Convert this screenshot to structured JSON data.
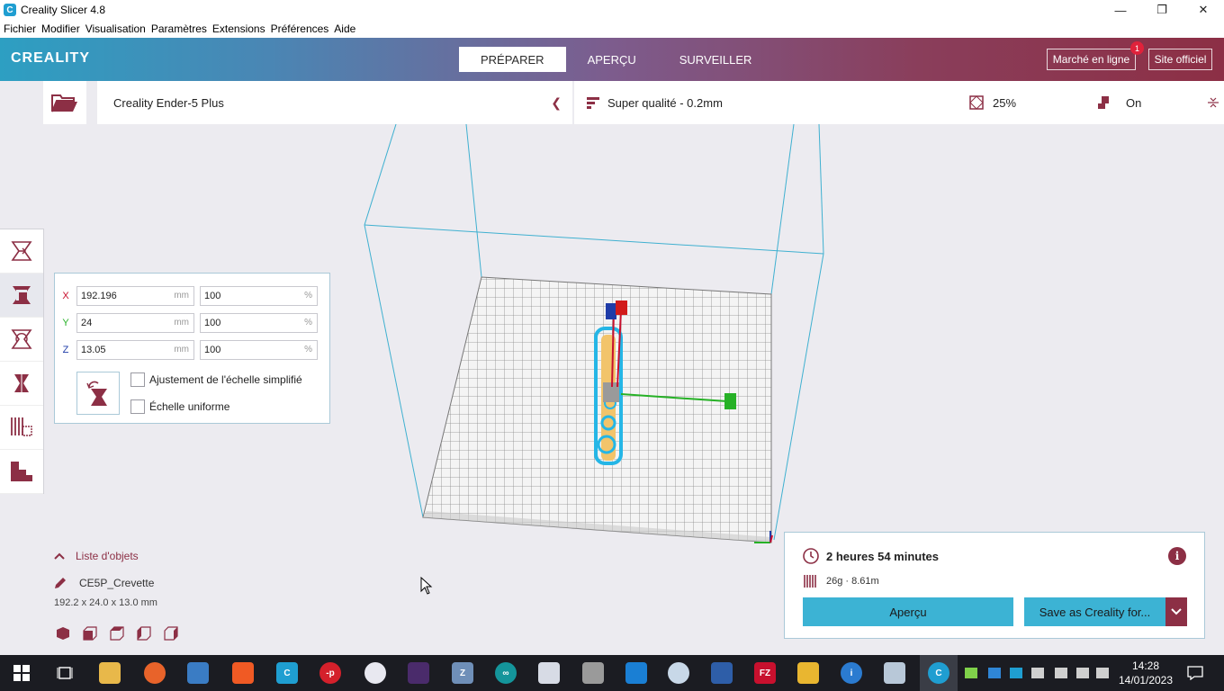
{
  "window": {
    "title": "Creality Slicer 4.8",
    "controls": {
      "minimize": "—",
      "maximize": "❐",
      "close": "✕"
    }
  },
  "menu": [
    "Fichier",
    "Modifier",
    "Visualisation",
    "Paramètres",
    "Extensions",
    "Préférences",
    "Aide"
  ],
  "header": {
    "logo": "CREALITY",
    "tabs": [
      "PRÉPARER",
      "APERÇU",
      "SURVEILLER"
    ],
    "active_tab": "PRÉPARER",
    "market_button": "Marché en ligne",
    "market_badge": "1",
    "official_button": "Site officiel"
  },
  "printer": {
    "name": "Creality Ender-5 Plus"
  },
  "settings": {
    "profile": "Super qualité - 0.2mm",
    "infill": "25%",
    "support": "On"
  },
  "scale_panel": {
    "x": {
      "label": "X",
      "mm": "192.196",
      "pct": "100",
      "color": "#c8102e"
    },
    "y": {
      "label": "Y",
      "mm": "24",
      "pct": "100",
      "color": "#26b126"
    },
    "z": {
      "label": "Z",
      "mm": "13.05",
      "pct": "100",
      "color": "#1f3ca8"
    },
    "unit_mm": "mm",
    "unit_pct": "%",
    "option_snap": "Ajustement de l'échelle simplifié",
    "option_uniform": "Échelle uniforme"
  },
  "object_list": {
    "header": "Liste d'objets",
    "object_name": "CE5P_Crevette",
    "dimensions": "192.2 x 24.0 x 13.0 mm"
  },
  "print_info": {
    "time": "2 heures 54 minutes",
    "material": "26g · 8.61m",
    "preview_button": "Aperçu",
    "save_button": "Save as Creality for..."
  },
  "taskbar": {
    "time": "14:28",
    "date": "14/01/2023"
  },
  "colors": {
    "accent": "#8c2f45",
    "button": "#3cb3d4",
    "build_volume": "#3fb0d0"
  }
}
